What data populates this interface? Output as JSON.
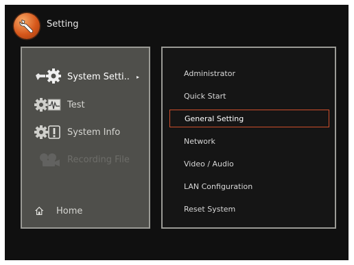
{
  "header": {
    "title": "Setting",
    "icon": "wrench-icon"
  },
  "left_menu": {
    "items": [
      {
        "label": "System Setti..",
        "icon": "wrench-gear-icon",
        "state": "selected",
        "arrow": "▸"
      },
      {
        "label": "Test",
        "icon": "gear-waveform-icon",
        "state": "normal"
      },
      {
        "label": "System Info",
        "icon": "gear-exclamation-icon",
        "state": "normal"
      },
      {
        "label": "Recording File",
        "icon": "film-reel-icon",
        "state": "disabled"
      }
    ],
    "home": {
      "label": "Home",
      "icon": "home-icon"
    }
  },
  "right_menu": {
    "items": [
      {
        "label": "Administrator"
      },
      {
        "label": "Quick Start"
      },
      {
        "label": "General Setting",
        "selected": true
      },
      {
        "label": "Network"
      },
      {
        "label": "Video / Audio"
      },
      {
        "label": "LAN Configuration"
      },
      {
        "label": "Reset System"
      }
    ]
  },
  "colors": {
    "background": "#101010",
    "left_panel": "#4f4f4b",
    "panel_border": "#9b9b96",
    "selection_border": "#d0502c",
    "logo_orange": "#d6571b"
  }
}
